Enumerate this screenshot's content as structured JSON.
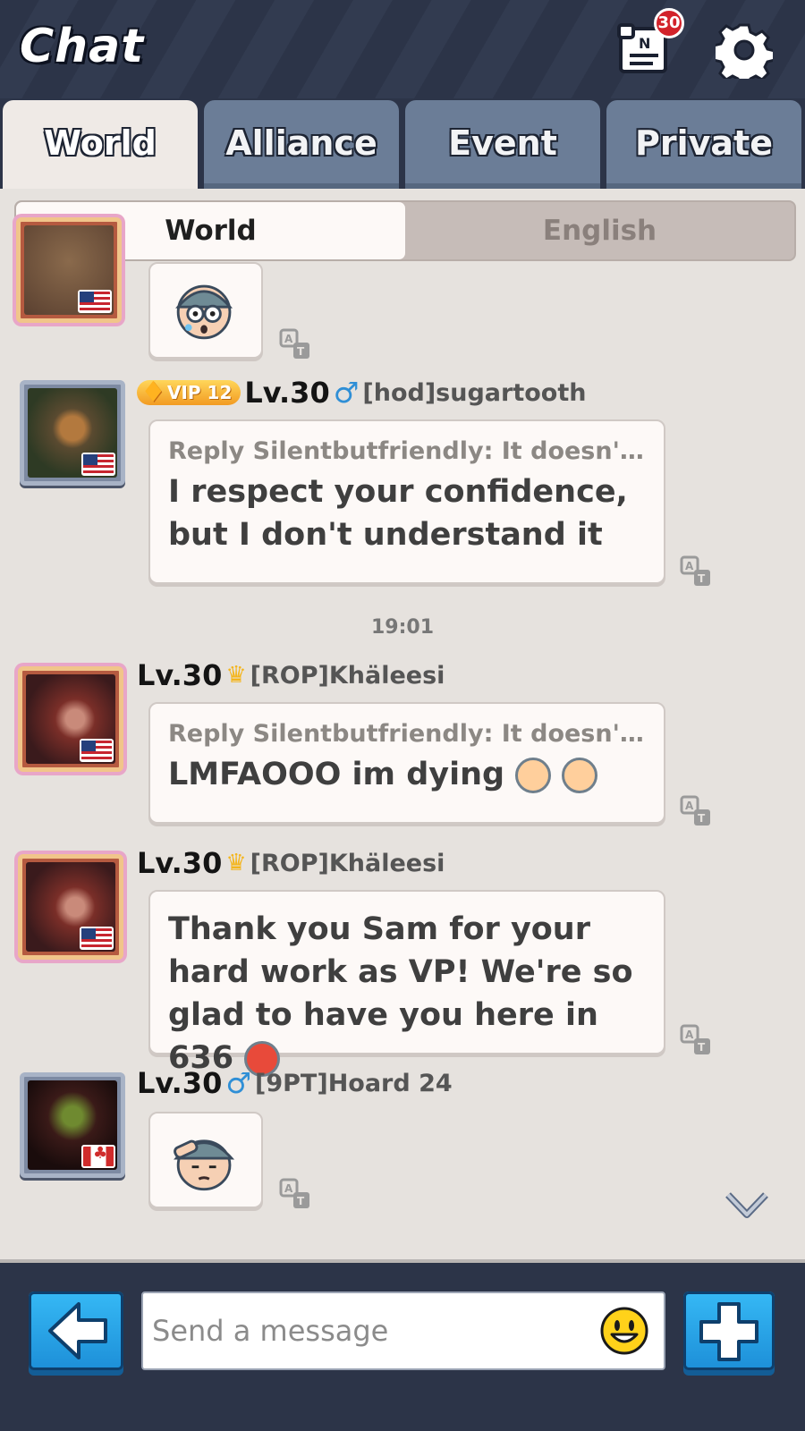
{
  "header": {
    "title": "Chat",
    "notes_badge_count": "30",
    "notes_icon": "scroll-notes-icon",
    "settings_icon": "gear-icon"
  },
  "tabs": [
    {
      "label": "World",
      "active": true
    },
    {
      "label": "Alliance",
      "active": false
    },
    {
      "label": "Event",
      "active": false
    },
    {
      "label": "Private",
      "active": false
    }
  ],
  "language_toggle": {
    "options": [
      "World",
      "English"
    ],
    "selected": "World"
  },
  "messages": [
    {
      "type": "sticker",
      "flag": "us",
      "sticker": "shocked-soldier-sticker"
    },
    {
      "type": "text",
      "vip": "VIP 12",
      "level": "Lv.30",
      "gender_icon": "♂",
      "username": "[hod]sugartooth",
      "flag": "us",
      "reply": "Reply Silentbutfriendly: It doesn't ...",
      "text": "I respect your confidence, but I don't understand it"
    },
    {
      "type": "time",
      "time": "19:01"
    },
    {
      "type": "text",
      "level": "Lv.30",
      "crown_icon": "crown-icon",
      "username": "[ROP]Khäleesi",
      "flag": "us",
      "reply": "Reply Silentbutfriendly: It doesn't ...",
      "text": "LMFAOOO im dying"
    },
    {
      "type": "text",
      "level": "Lv.30",
      "crown_icon": "crown-icon",
      "username": "[ROP]Khäleesi",
      "flag": "us",
      "text": "Thank you Sam for your hard work as VP! We're so glad to have you here in 636"
    },
    {
      "type": "sticker",
      "level": "Lv.30",
      "gender_icon": "♂",
      "username": "[9PT]Hoard 24",
      "flag": "ca",
      "sticker": "saluting-soldier-sticker"
    }
  ],
  "footer": {
    "input_placeholder": "Send a message",
    "back_icon": "arrow-left-icon",
    "emoji_icon": "smiley-icon",
    "add_icon": "plus-icon"
  },
  "colors": {
    "header_bg": "#2c3448",
    "tab_inactive": "#6b7d97",
    "content_bg": "#e6e2de",
    "button_blue": "#1d8fd8"
  }
}
